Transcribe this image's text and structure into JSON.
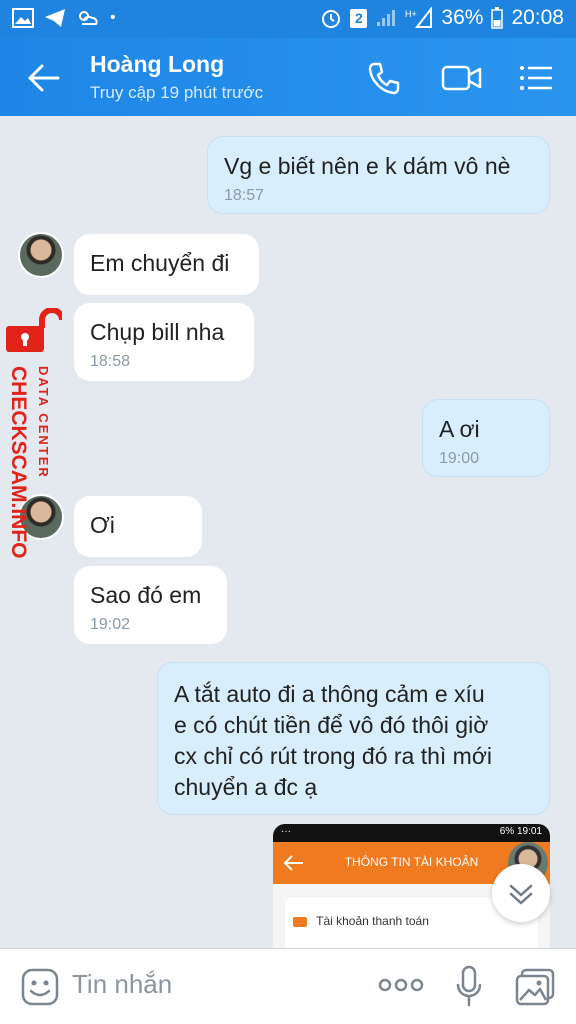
{
  "status_bar": {
    "sim": "2",
    "battery": "36%",
    "time": "20:08",
    "icons": [
      "image-icon",
      "telegram-icon",
      "weather-icon",
      "alarm-icon",
      "signal-icon",
      "battery-icon"
    ]
  },
  "header": {
    "name": "Hoàng Long",
    "status": "Truy cập 19 phút trước",
    "icons": [
      "back-arrow-icon",
      "phone-icon",
      "video-icon",
      "menu-icon"
    ]
  },
  "messages": [
    {
      "dir": "out",
      "text": "Vg e biết nên e k dám vô nè",
      "time": "18:57"
    },
    {
      "dir": "in",
      "text": "Em chuyển đi",
      "time": ""
    },
    {
      "dir": "in",
      "text": "Chụp bill nha",
      "time": "18:58"
    },
    {
      "dir": "out",
      "text": "A ơi",
      "time": "19:00"
    },
    {
      "dir": "in",
      "text": "Ơi",
      "time": ""
    },
    {
      "dir": "in",
      "text": "Sao đó em",
      "time": "19:02"
    },
    {
      "dir": "out",
      "lines": [
        "A tắt auto đi a thông cảm e xíu",
        "e có chút tiền để vô đó thôi giờ",
        "cx chỉ có rút trong đó ra thì mới",
        "chuyển a đc ạ"
      ],
      "time": ""
    }
  ],
  "watermark": {
    "brand": "CHECKSCAM.INFO",
    "sub": "DATA CENTER",
    "color": "#e2231a"
  },
  "image_preview": {
    "title": "THÔNG TIN TÀI KHOẢN",
    "item": "Tài khoản thanh toán",
    "mini_status_left": "··· ",
    "mini_status_right": "6% 19:01"
  },
  "composer": {
    "placeholder": "Tin nhắn",
    "icons": [
      "emoji-icon",
      "more-icon",
      "microphone-icon",
      "gallery-icon"
    ]
  },
  "colors": {
    "accent": "#1f84e0",
    "outgoing_bubble": "#d9eefc",
    "incoming_bubble": "#ffffff",
    "background": "#e3e9ef"
  }
}
